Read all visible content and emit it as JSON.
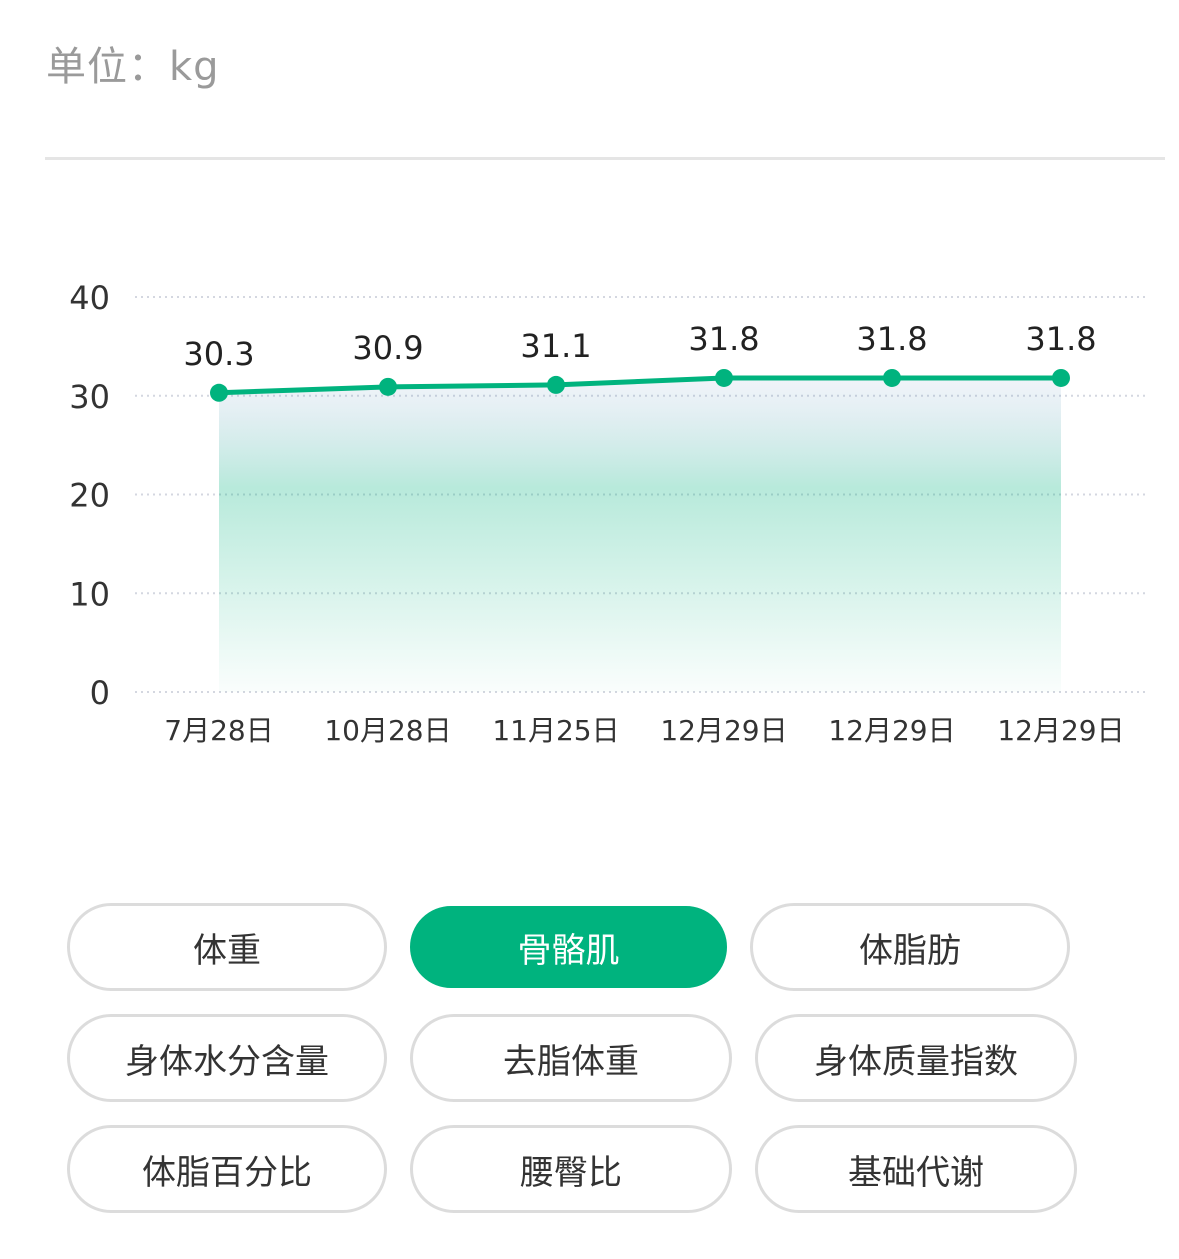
{
  "header": {
    "unit_label": "单位：kg"
  },
  "chart_data": {
    "type": "area",
    "categories": [
      "7月28日",
      "10月28日",
      "11月25日",
      "12月29日",
      "12月29日",
      "12月29日"
    ],
    "series": [
      {
        "values": [
          30.3,
          30.9,
          31.1,
          31.8,
          31.8,
          31.8
        ]
      }
    ],
    "data_labels": [
      "30.3",
      "30.9",
      "31.1",
      "31.8",
      "31.8",
      "31.8"
    ],
    "y_ticks": [
      "0",
      "10",
      "20",
      "30",
      "40"
    ],
    "ylim": [
      0,
      40
    ],
    "grid": true,
    "line_color": "#00b37e",
    "fill_color": "#00b37e",
    "label_color": "#222222",
    "axis_text_color": "#333333"
  },
  "metrics": {
    "active_color": "#00b37e",
    "items": [
      {
        "label": "体重",
        "active": false
      },
      {
        "label": "骨骼肌",
        "active": true
      },
      {
        "label": "体脂肪",
        "active": false
      },
      {
        "label": "身体水分含量",
        "active": false
      },
      {
        "label": "去脂体重",
        "active": false
      },
      {
        "label": "身体质量指数",
        "active": false
      },
      {
        "label": "体脂百分比",
        "active": false
      },
      {
        "label": "腰臀比",
        "active": false
      },
      {
        "label": "基础代谢",
        "active": false
      }
    ]
  }
}
